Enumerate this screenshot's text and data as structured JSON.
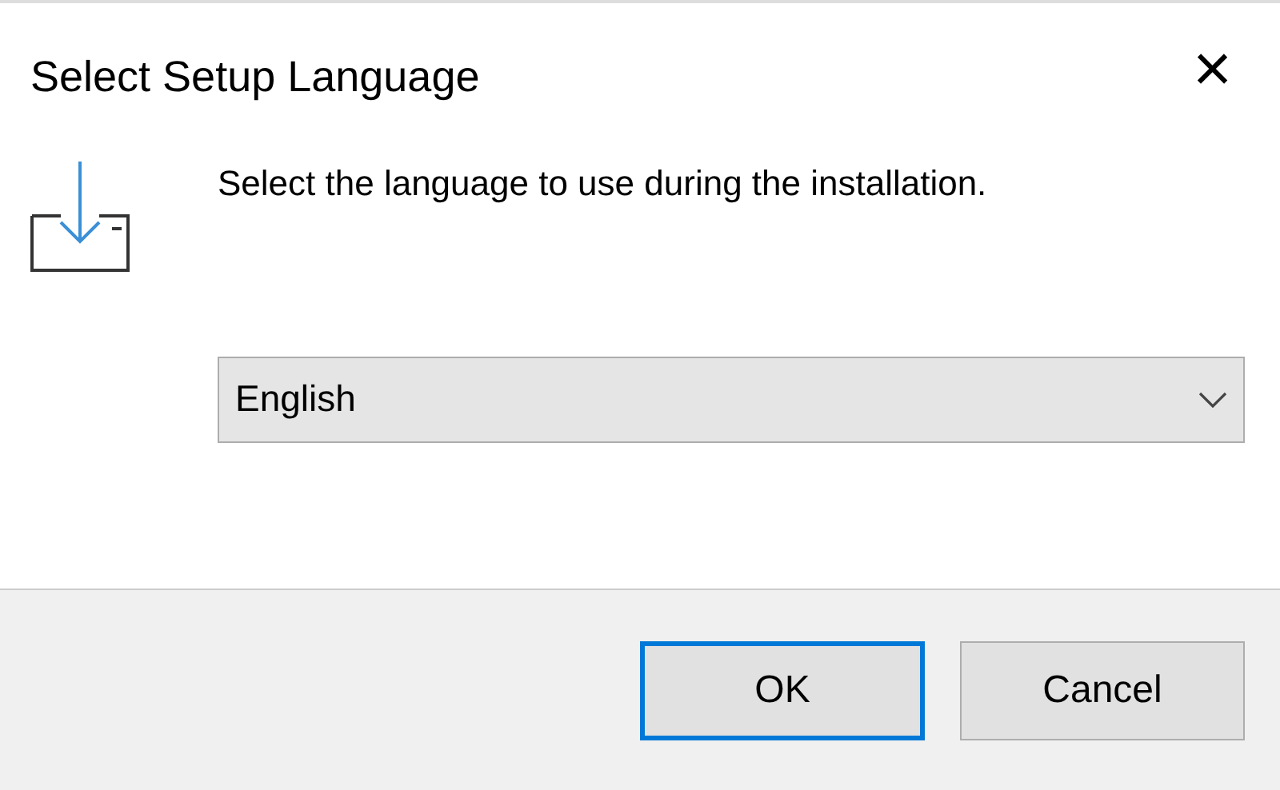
{
  "window": {
    "title": "Select Setup Language",
    "close": "×"
  },
  "message": "Select the language to use during the installation.",
  "language_select": {
    "value": "English"
  },
  "buttons": [
    {
      "label": "OK",
      "default": true
    },
    {
      "label": "Cancel",
      "default": false
    }
  ]
}
